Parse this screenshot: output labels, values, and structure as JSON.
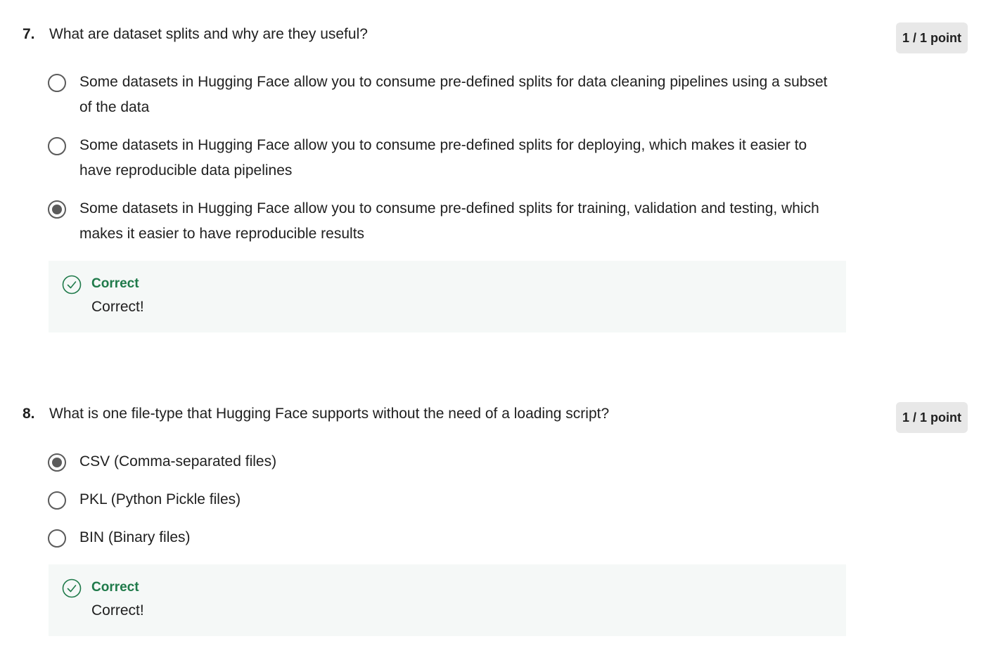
{
  "questions": [
    {
      "number": "7.",
      "text": "What are dataset splits and why are they useful?",
      "points": "1 / 1 point",
      "options": [
        {
          "label": "Some datasets in Hugging Face allow you to consume pre-defined splits for data cleaning pipelines using a subset of the data",
          "selected": false
        },
        {
          "label": "Some datasets in Hugging Face allow you to consume pre-defined splits for deploying, which makes it easier to have reproducible data pipelines",
          "selected": false
        },
        {
          "label": "Some datasets in Hugging Face allow you to consume pre-defined splits for training, validation and testing, which makes it easier to have reproducible results",
          "selected": true
        }
      ],
      "feedback": {
        "status": "Correct",
        "message": "Correct!",
        "icon": "check-circle-icon"
      }
    },
    {
      "number": "8.",
      "text": "What is one file-type that Hugging Face supports without the need of a loading script?",
      "points": "1 / 1 point",
      "options": [
        {
          "label": "CSV (Comma-separated files)",
          "selected": true
        },
        {
          "label": "PKL (Python Pickle files)",
          "selected": false
        },
        {
          "label": "BIN (Binary files)",
          "selected": false
        }
      ],
      "feedback": {
        "status": "Correct",
        "message": "Correct!",
        "icon": "check-circle-icon"
      }
    }
  ],
  "colors": {
    "correct_green": "#1f7a4a",
    "feedback_bg": "#f5f8f7",
    "badge_bg": "#e8e8e8"
  }
}
